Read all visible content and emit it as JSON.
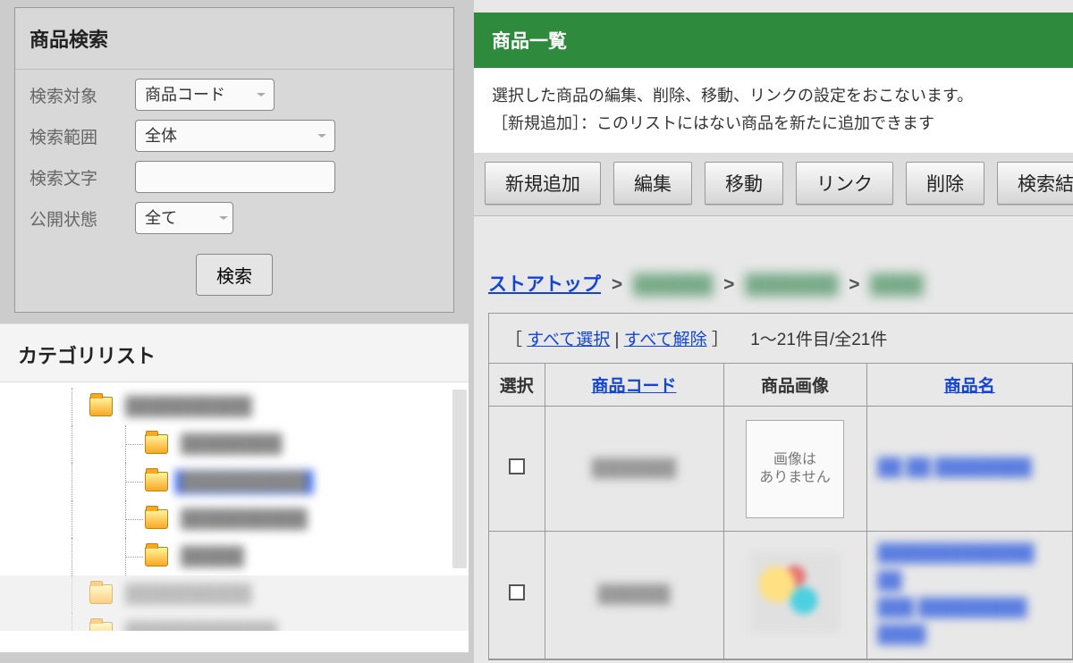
{
  "search": {
    "title": "商品検索",
    "rows": {
      "target_label": "検索対象",
      "target_value": "商品コード",
      "scope_label": "検索範囲",
      "scope_value": "全体",
      "text_label": "検索文字",
      "text_value": "",
      "status_label": "公開状態",
      "status_value": "全て"
    },
    "button": "検索"
  },
  "category": {
    "title": "カテゴリリスト",
    "items": [
      {
        "depth": 0,
        "expander": "-",
        "label": "██████████",
        "selected": false
      },
      {
        "depth": 1,
        "label": "████████",
        "selected": false
      },
      {
        "depth": 1,
        "label": "██████████",
        "selected": true
      },
      {
        "depth": 1,
        "label": "██████████",
        "selected": false
      },
      {
        "depth": 1,
        "label": "█████",
        "selected": false
      },
      {
        "depth": 0,
        "label": "██████████",
        "selected": false,
        "dim": true
      },
      {
        "depth": 0,
        "label": "████████████",
        "selected": false,
        "dim": true
      }
    ]
  },
  "list": {
    "green_title": "商品一覧",
    "desc1": "選択した商品の編集、削除、移動、リンクの設定をおこないます。",
    "desc2": "［新規追加］：このリストにはない商品を新たに追加できます",
    "buttons": [
      "新規追加",
      "編集",
      "移動",
      "リンク",
      "削除",
      "検索結果を"
    ],
    "breadcrumb": {
      "top": "ストアトップ",
      "sep": ">",
      "b1": "██████",
      "b2": "███████",
      "b3": "████"
    },
    "controls": {
      "open": "［",
      "select_all": "すべて選択",
      "bar": " | ",
      "deselect_all": "すべて解除",
      "close": " ］",
      "count": "　1～21件目/全21件"
    },
    "headers": {
      "sel": "選択",
      "code": "商品コード",
      "img": "商品画像",
      "name": "商品名"
    },
    "noimage_l1": "画像は",
    "noimage_l2": "ありません",
    "rows": [
      {
        "code": "███████",
        "img": "none",
        "name": "██ ██ ████████"
      },
      {
        "code": "██████",
        "img": "blur",
        "name": "█████████████\n██\n███ █████████\n████"
      }
    ]
  }
}
